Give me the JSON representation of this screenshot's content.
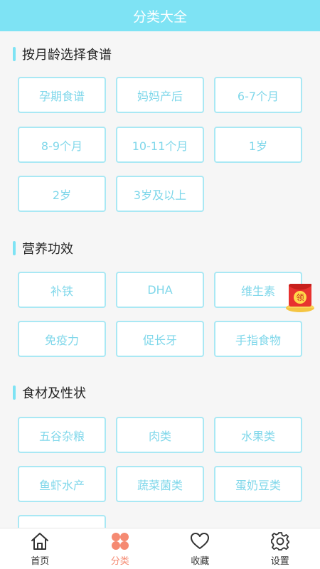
{
  "header": {
    "title": "分类大全"
  },
  "sections": [
    {
      "title": "按月龄选择食谱",
      "tags": [
        "孕期食谱",
        "妈妈产后",
        "6-7个月",
        "8-9个月",
        "10-11个月",
        "1岁",
        "2岁",
        "3岁及以上"
      ]
    },
    {
      "title": "营养功效",
      "tags": [
        "补铁",
        "DHA",
        "维生素",
        "免疫力",
        "促长牙",
        "手指食物"
      ]
    },
    {
      "title": "食材及性状",
      "tags": [
        "五谷杂粮",
        "肉类",
        "水果类",
        "鱼虾水产",
        "蔬菜菌类",
        "蛋奶豆类",
        ""
      ]
    }
  ],
  "badge": {
    "label": "领",
    "icon": "red-packet-icon"
  },
  "tabbar": [
    {
      "label": "首页",
      "icon": "home-icon"
    },
    {
      "label": "分类",
      "icon": "category-icon",
      "active": true
    },
    {
      "label": "收藏",
      "icon": "heart-icon"
    },
    {
      "label": "设置",
      "icon": "gear-icon"
    }
  ],
  "colors": {
    "accent": "#7ee3f4",
    "tag_border": "#a9e8f4",
    "tag_text": "#7fd7ea",
    "active_tab": "#f58a72"
  }
}
